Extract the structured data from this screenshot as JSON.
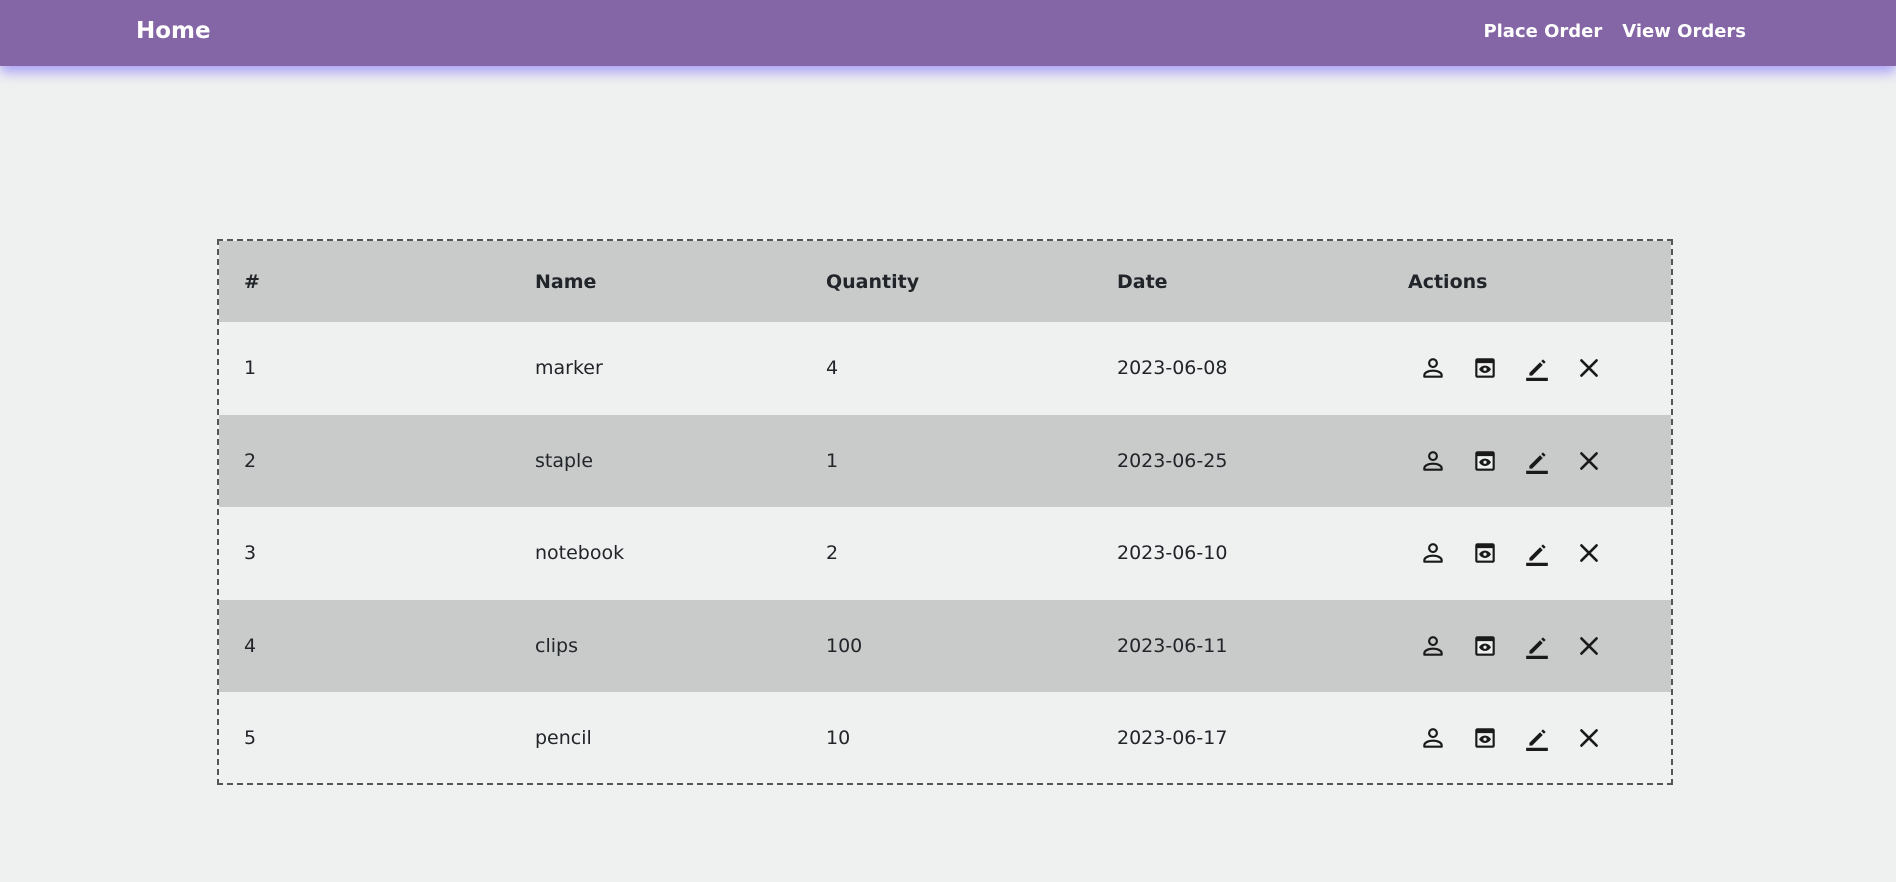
{
  "nav": {
    "brand": "Home",
    "links": [
      "Place Order",
      "View Orders"
    ],
    "color": "#8465a5"
  },
  "table": {
    "headers": [
      "#",
      "Name",
      "Quantity",
      "Date",
      "Actions"
    ],
    "rows": [
      {
        "id": "1",
        "name": "marker",
        "quantity": "4",
        "date": "2023-06-08"
      },
      {
        "id": "2",
        "name": "staple",
        "quantity": "1",
        "date": "2023-06-25"
      },
      {
        "id": "3",
        "name": "notebook",
        "quantity": "2",
        "date": "2023-06-10"
      },
      {
        "id": "4",
        "name": "clips",
        "quantity": "100",
        "date": "2023-06-11"
      },
      {
        "id": "5",
        "name": "pencil",
        "quantity": "10",
        "date": "2023-06-17"
      }
    ],
    "action_icons": [
      "person-icon",
      "view-icon",
      "edit-icon",
      "close-icon"
    ]
  }
}
